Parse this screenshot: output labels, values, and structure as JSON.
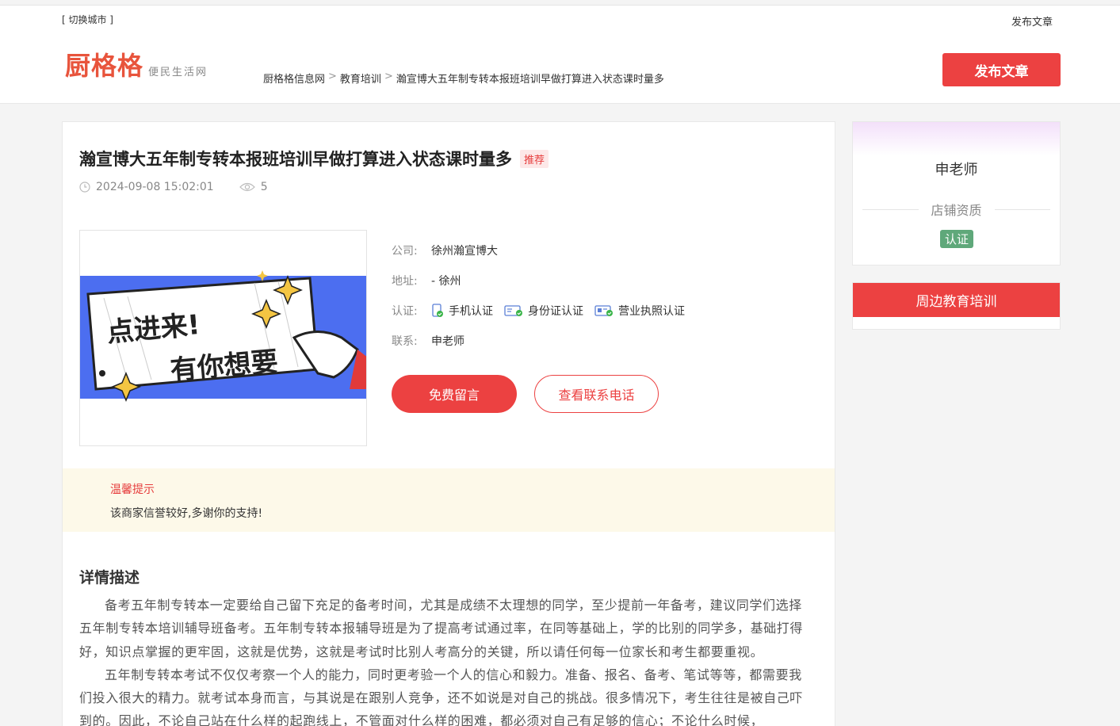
{
  "topbar": {
    "switch_city": "[ 切换城市 ]",
    "publish_link": "发布文章"
  },
  "header": {
    "logo_main": "厨格格",
    "logo_sub": "便民生活网",
    "publish_button": "发布文章",
    "breadcrumb": [
      "厨格格信息网",
      "教育培训",
      "瀚宣博大五年制专转本报班培训早做打算进入状态课时量多"
    ],
    "breadcrumb_sep": ">"
  },
  "article": {
    "title": "瀚宣博大五年制专转本报班培训早做打算进入状态课时量多",
    "tag": "推荐",
    "datetime": "2024-09-08 15:02:01",
    "views": "5",
    "banner_line1": "点进来!",
    "banner_line2": "有你想要",
    "company_label": "公司:",
    "company": "徐州瀚宣博大",
    "address_label": "地址:",
    "address": "- 徐州",
    "cert_label": "认证:",
    "certs": [
      "手机认证",
      "身份证认证",
      "营业执照认证"
    ],
    "contact_label": "联系:",
    "contact": "申老师",
    "btn_message": "免费留言",
    "btn_phone": "查看联系电话"
  },
  "tip": {
    "title": "温馨提示",
    "text": "该商家信誉较好,多谢你的支持!"
  },
  "description": {
    "title": "详情描述",
    "paragraphs": [
      "备考五年制专转本一定要给自己留下充足的备考时间，尤其是成绩不太理想的同学，至少提前一年备考，建议同学们选择五年制专转本培训辅导班备考。五年制专转本报辅导班是为了提高考试通过率，在同等基础上，学的比别的同学多，基础打得好，知识点掌握的更牢固，这就是优势，这就是考试时比别人考高分的关键，所以请任何每一位家长和考生都要重视。",
      "五年制专转本考试不仅仅考察一个人的能力，同时更考验一个人的信心和毅力。准备、报名、备考、笔试等等，都需要我们投入很大的精力。就考试本身而言，与其说是在跟别人竞争，还不如说是对自己的挑战。很多情况下，考生往往是被自己吓到的。因此，不论自己站在什么样的起跑线上，不管面对什么样的困难，都必须对自己有足够的信心；不论什么时候，"
    ]
  },
  "sidebar": {
    "name": "申老师",
    "qualification": "店铺资质",
    "verified": "认证",
    "nearby_title": "周边教育培训"
  },
  "colors": {
    "accent": "#ec4141",
    "logo": "#e8543c",
    "verified": "#5fa87a",
    "tip_bg": "#fdf9e9"
  }
}
